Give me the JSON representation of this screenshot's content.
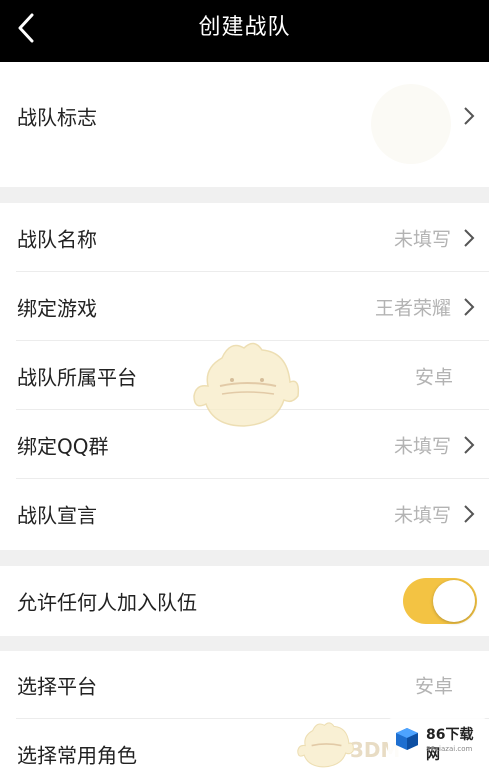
{
  "header": {
    "title": "创建战队",
    "back_icon": "chevron-left-icon"
  },
  "logo_row": {
    "label": "战队标志"
  },
  "info_rows": [
    {
      "label": "战队名称",
      "value": "未填写",
      "has_chevron": true
    },
    {
      "label": "绑定游戏",
      "value": "王者荣耀",
      "has_chevron": true
    },
    {
      "label": "战队所属平台",
      "value": "安卓",
      "has_chevron": false
    },
    {
      "label": "绑定QQ群",
      "value": "未填写",
      "has_chevron": true
    },
    {
      "label": "战队宣言",
      "value": "未填写",
      "has_chevron": true
    }
  ],
  "toggle_row": {
    "label": "允许任何人加入队伍",
    "enabled": true
  },
  "bottom_rows": [
    {
      "label": "选择平台",
      "value": "安卓"
    },
    {
      "label": "选择常用角色",
      "value": ""
    }
  ],
  "watermark": {
    "brand_3dm": "3DM",
    "brand_86": "86下载网",
    "brand_86_sub": "86xiazai.com"
  },
  "colors": {
    "header_bg": "#000000",
    "toggle_on": "#f3c343",
    "value_text": "#b3b3b3",
    "label_text": "#222222",
    "page_bg": "#f0f0f0"
  }
}
